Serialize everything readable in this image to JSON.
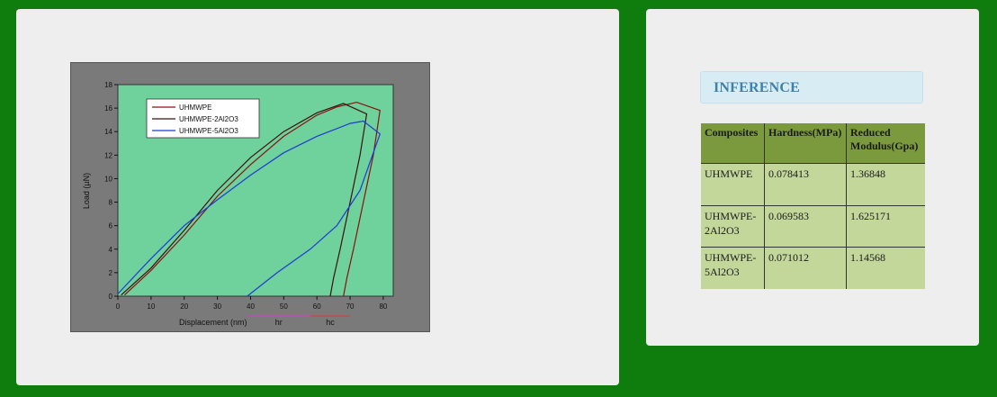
{
  "chart_data": {
    "type": "line",
    "xlabel": "Displacement (nm)",
    "ylabel": "Load (µN)",
    "xlim": [
      0,
      83
    ],
    "ylim": [
      0,
      18
    ],
    "xticks": [
      0,
      10,
      20,
      30,
      40,
      50,
      60,
      70,
      80
    ],
    "yticks": [
      0,
      2,
      4,
      6,
      8,
      10,
      12,
      14,
      16,
      18
    ],
    "legend_position": "top-left",
    "series": [
      {
        "name": "UHMWPE",
        "color": "#8a1010",
        "points": [
          [
            2,
            0.1
          ],
          [
            10,
            2.2
          ],
          [
            20,
            5.2
          ],
          [
            30,
            8.5
          ],
          [
            40,
            11.2
          ],
          [
            50,
            13.6
          ],
          [
            60,
            15.4
          ],
          [
            66,
            16.1
          ],
          [
            72,
            16.5
          ],
          [
            79,
            15.8
          ],
          [
            77,
            12
          ],
          [
            74,
            8
          ],
          [
            71,
            4
          ],
          [
            69,
            1.5
          ],
          [
            68,
            0
          ]
        ]
      },
      {
        "name": "UHMWPE-2Al2O3",
        "color": "#3a1010",
        "points": [
          [
            1,
            0.1
          ],
          [
            10,
            2.4
          ],
          [
            20,
            5.6
          ],
          [
            30,
            9
          ],
          [
            40,
            11.8
          ],
          [
            50,
            14
          ],
          [
            60,
            15.6
          ],
          [
            68,
            16.4
          ],
          [
            75,
            15.5
          ],
          [
            73,
            12
          ],
          [
            70,
            8
          ],
          [
            67,
            4
          ],
          [
            65,
            1.5
          ],
          [
            64,
            0
          ]
        ]
      },
      {
        "name": "UHMWPE-5Al2O3",
        "color": "#1e3ad6",
        "points": [
          [
            0,
            0.2
          ],
          [
            10,
            3.2
          ],
          [
            20,
            6
          ],
          [
            30,
            8.2
          ],
          [
            40,
            10.3
          ],
          [
            50,
            12.2
          ],
          [
            60,
            13.6
          ],
          [
            70,
            14.7
          ],
          [
            74,
            14.9
          ],
          [
            79,
            13.8
          ],
          [
            73,
            9
          ],
          [
            66,
            6
          ],
          [
            58,
            4
          ],
          [
            48,
            2
          ],
          [
            39,
            0
          ]
        ]
      }
    ],
    "annotations": {
      "hr": {
        "label": "hr",
        "from": 39,
        "to": 58
      },
      "hc": {
        "label": "hc",
        "from": 58,
        "to": 70
      }
    }
  },
  "inference": {
    "title": "INFERENCE"
  },
  "table": {
    "headers": [
      "Composites",
      "Hardness(MPa)",
      "Reduced Modulus(Gpa)"
    ],
    "rows": [
      [
        "UHMWPE",
        "0.078413",
        "1.36848"
      ],
      [
        "UHMWPE-2Al2O3",
        "0.069583",
        "1.625171"
      ],
      [
        "UHMWPE-5Al2O3",
        "0.071012",
        "1.14568"
      ]
    ]
  }
}
